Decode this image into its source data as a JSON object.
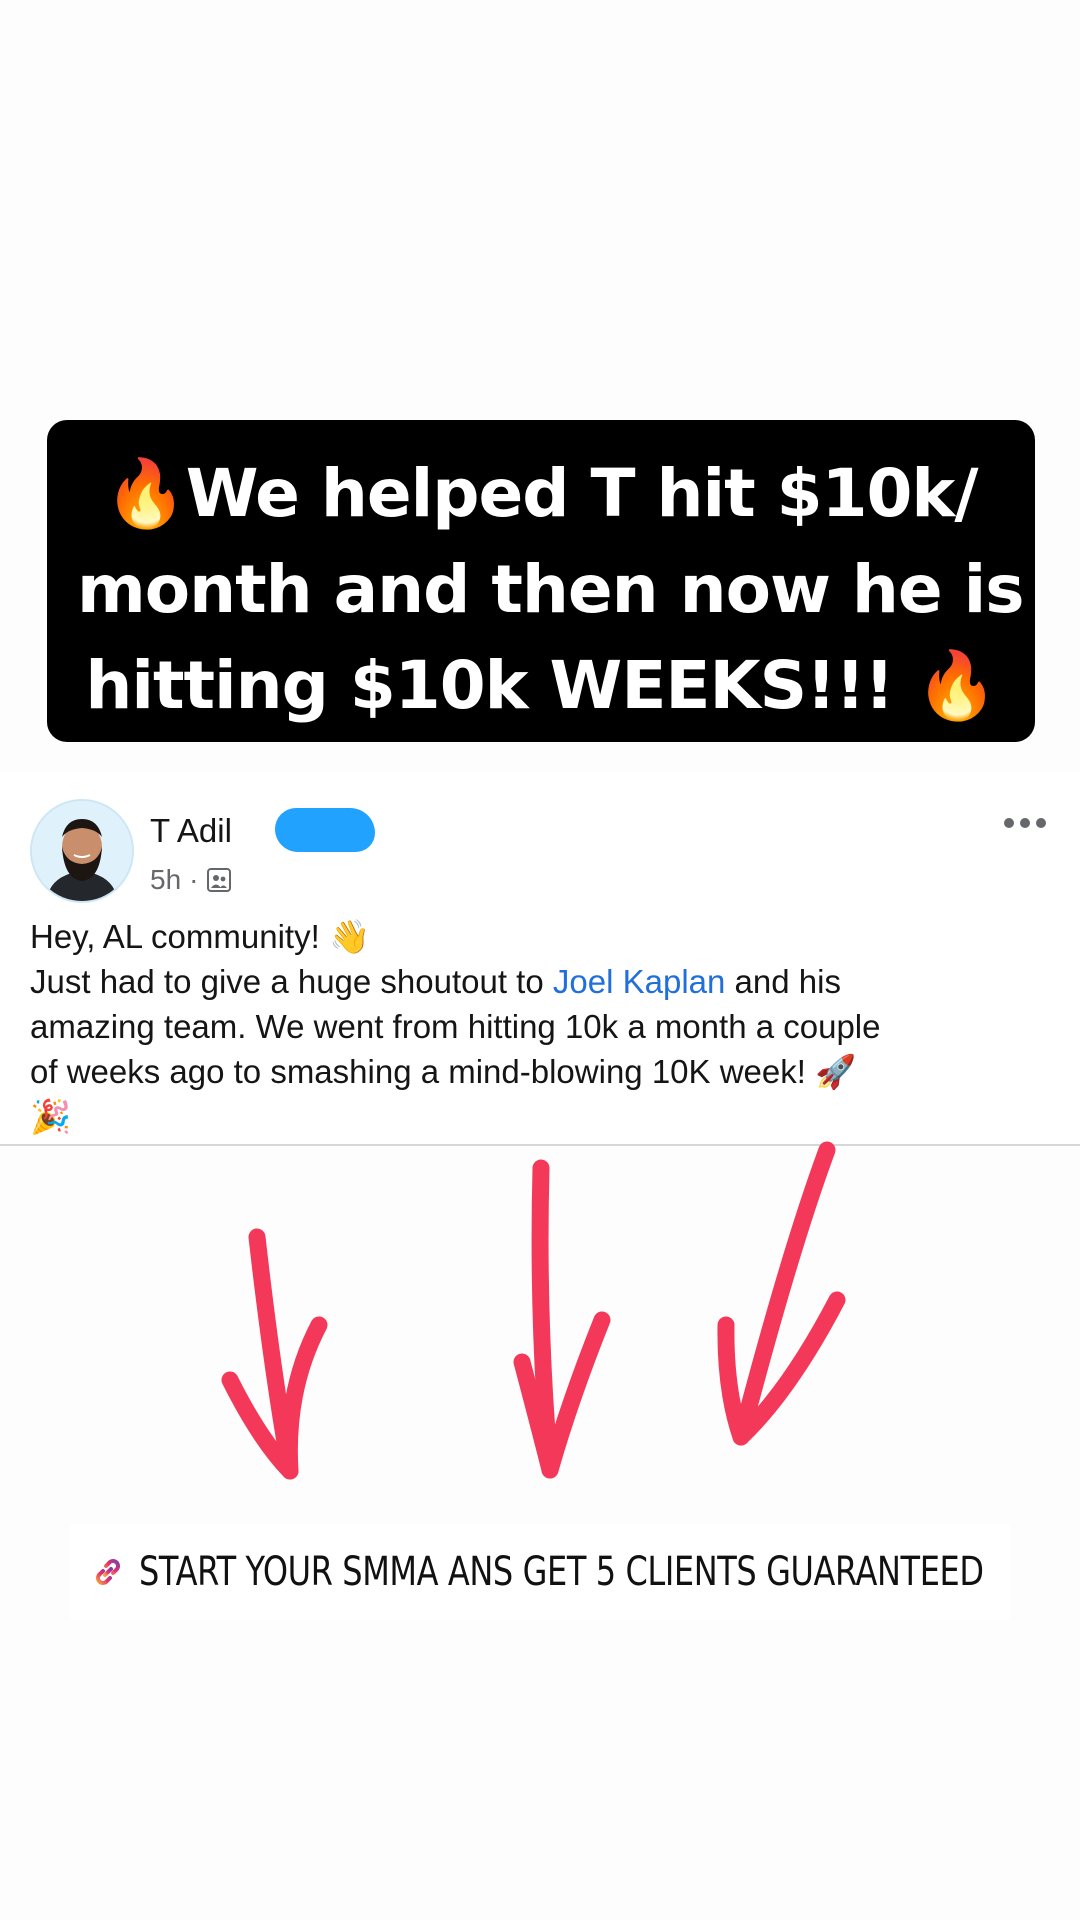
{
  "headline": {
    "lines": [
      "We helped T hit $10k/",
      "month and then now he is",
      "hitting $10k WEEKS!!!"
    ],
    "emoji_left": "🔥",
    "emoji_right": "🔥"
  },
  "post": {
    "author": "T Adil",
    "time": "5h",
    "separator": "·",
    "audience_icon": "group-icon",
    "greeting": "Hey, AL community!",
    "greeting_emoji": "👋",
    "line2_pre": "Just had to give a huge shoutout to ",
    "mention": "Joel Kaplan",
    "line2_post": " and his",
    "line3": "amazing team. We went from hitting 10k a month a couple",
    "line4": "of weeks ago to smashing a mind-blowing 10K week!",
    "line4_emoji": "🚀",
    "line5_emoji": "🎉"
  },
  "cta": {
    "icon": "link-icon",
    "text": "START YOUR SMMA ANS GET 5 CLIENTS GUARANTEED"
  },
  "colors": {
    "arrow": "#f4385a",
    "mention": "#216fdb",
    "redaction": "#22a2ff"
  }
}
